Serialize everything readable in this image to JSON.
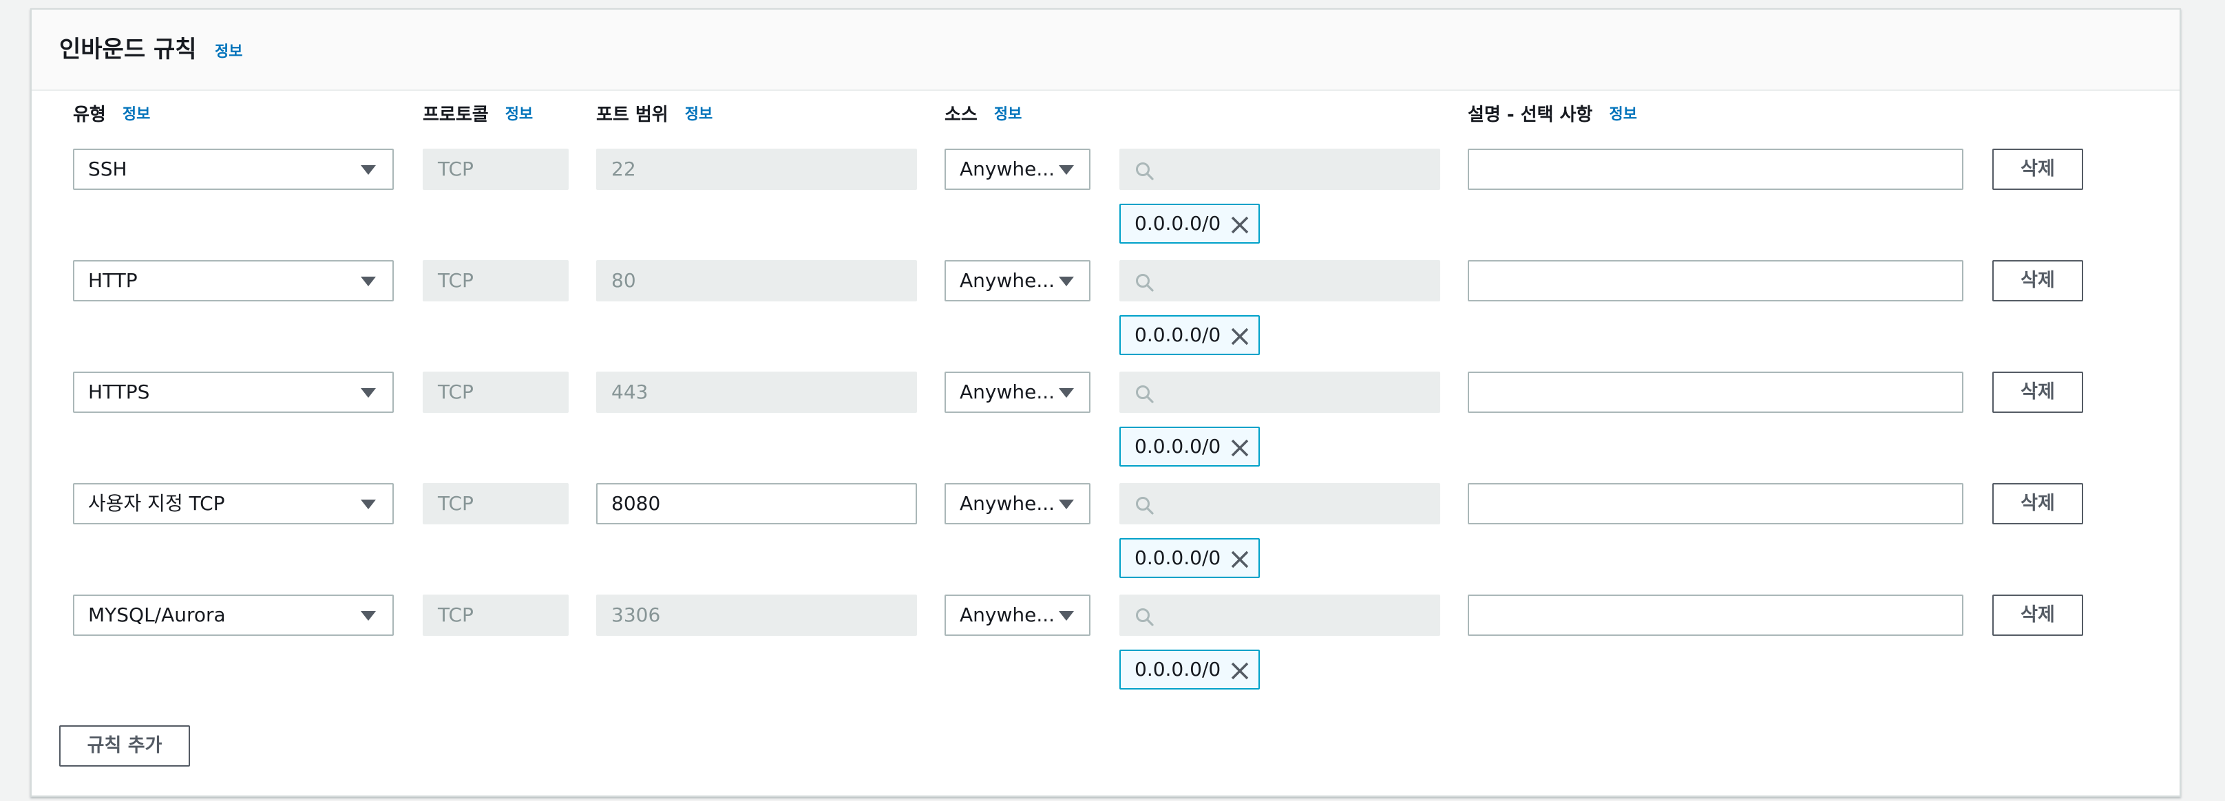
{
  "panel": {
    "title": "인바운드 규칙",
    "info": "정보"
  },
  "columns": {
    "type": "유형",
    "protocol": "프로토콜",
    "port_range": "포트 범위",
    "source": "소스",
    "description": "설명 - 선택 사항",
    "info": "정보"
  },
  "rules": [
    {
      "type": "SSH",
      "protocol": "TCP",
      "port": "22",
      "source": "Anywhe...",
      "cidr": "0.0.0.0/0",
      "description": "",
      "delete_label": "삭제"
    },
    {
      "type": "HTTP",
      "protocol": "TCP",
      "port": "80",
      "source": "Anywhe...",
      "cidr": "0.0.0.0/0",
      "description": "",
      "delete_label": "삭제"
    },
    {
      "type": "HTTPS",
      "protocol": "TCP",
      "port": "443",
      "source": "Anywhe...",
      "cidr": "0.0.0.0/0",
      "description": "",
      "delete_label": "삭제"
    },
    {
      "type": "사용자 지정 TCP",
      "protocol": "TCP",
      "port": "8080",
      "source": "Anywhe...",
      "cidr": "0.0.0.0/0",
      "description": "",
      "delete_label": "삭제"
    },
    {
      "type": "MYSQL/Aurora",
      "protocol": "TCP",
      "port": "3306",
      "source": "Anywhe...",
      "cidr": "0.0.0.0/0",
      "description": "",
      "delete_label": "삭제"
    }
  ],
  "add_rule_label": "규칙 추가",
  "icons": {
    "search": "search-icon",
    "close": "close-icon",
    "caret": "caret-down-icon"
  },
  "colors": {
    "link": "#0073bb",
    "token_border": "#00a1c9",
    "token_bg": "#f1faff",
    "disabled_bg": "#eaeded"
  }
}
